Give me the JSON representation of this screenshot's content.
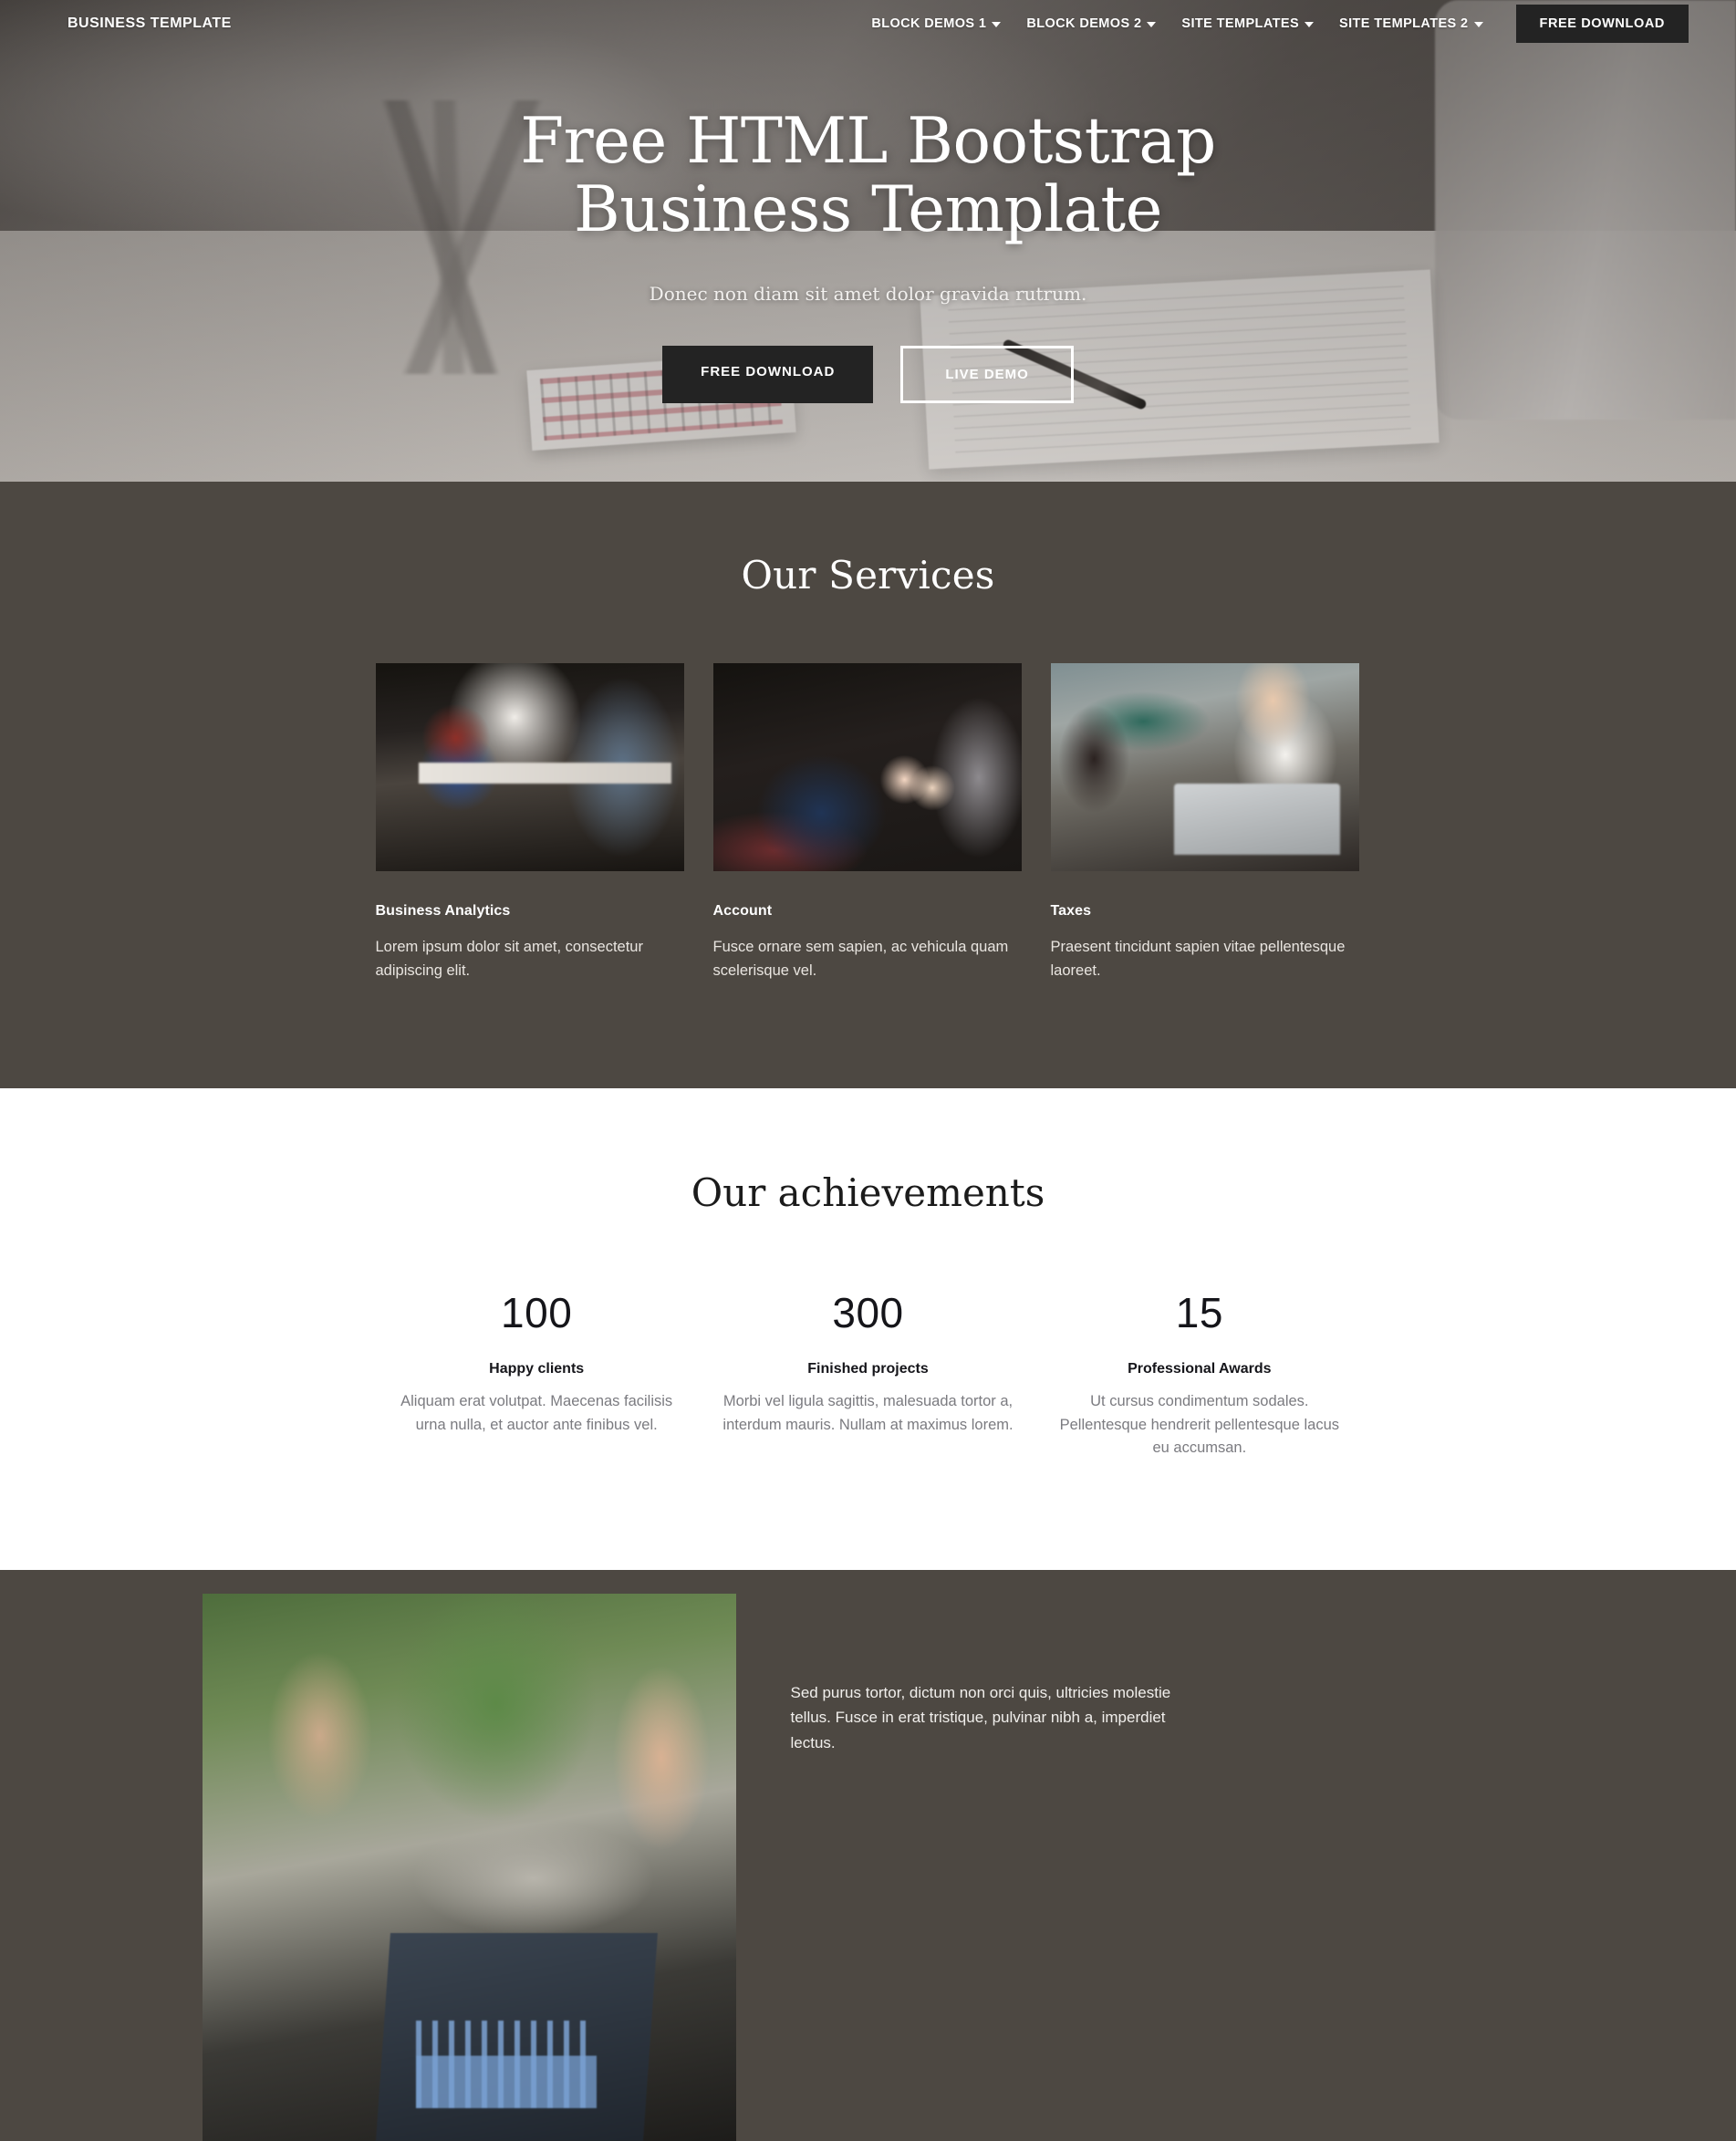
{
  "navbar": {
    "brand": "BUSINESS TEMPLATE",
    "items": [
      {
        "label": "BLOCK DEMOS 1",
        "icon": "chevron-down-icon"
      },
      {
        "label": "BLOCK DEMOS 2",
        "icon": "chevron-down-icon"
      },
      {
        "label": "SITE TEMPLATES",
        "icon": "chevron-down-icon"
      },
      {
        "label": "SITE TEMPLATES 2",
        "icon": "chevron-down-icon"
      }
    ],
    "cta_label": "FREE DOWNLOAD",
    "cta_color": "#232323"
  },
  "hero": {
    "title_line1": "Free HTML Bootstrap",
    "title_line2": "Business Template",
    "subtitle": "Donec non diam sit amet dolor gravida rutrum.",
    "primary_button": "FREE DOWNLOAD",
    "secondary_button": "LIVE DEMO"
  },
  "services": {
    "title": "Our Services",
    "bg_color": "#4d4842",
    "cards": [
      {
        "image_alt": "people-meeting-laptop-photo",
        "name": "Business Analytics",
        "text": "Lorem ipsum dolor sit amet, consectetur adipiscing elit."
      },
      {
        "image_alt": "conference-audience-notes-photo",
        "name": "Account",
        "text": "Fusce ornare sem sapien, ac vehicula quam scelerisque vel."
      },
      {
        "image_alt": "cafe-meeting-laptop-photo",
        "name": "Taxes",
        "text": "Praesent tincidunt sapien vitae pellentesque laoreet."
      }
    ]
  },
  "achievements": {
    "title": "Our achievements",
    "bg_color": "#ffffff",
    "items": [
      {
        "number": "100",
        "label": "Happy clients",
        "text": "Aliquam erat volutpat. Maecenas facilisis urna nulla, et auctor ante finibus vel."
      },
      {
        "number": "300",
        "label": "Finished projects",
        "text": "Morbi vel ligula sagittis, malesuada tortor a, interdum mauris. Nullam at maximus lorem."
      },
      {
        "number": "15",
        "label": "Professional Awards",
        "text": "Ut cursus condimentum sodales. Pellentesque hendrerit pellentesque lacus eu accumsan."
      }
    ]
  },
  "bottom": {
    "bg_color": "#4d4842",
    "image_alt": "two-people-talking-outdoors-photo",
    "text": "Sed purus tortor, dictum non orci quis, ultricies molestie tellus. Fusce in erat tristique, pulvinar nibh a, imperdiet lectus."
  }
}
